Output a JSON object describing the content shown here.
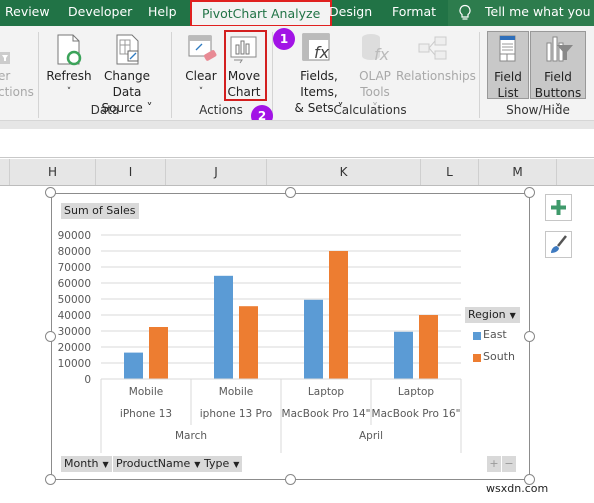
{
  "tabs": [
    {
      "label": "Review"
    },
    {
      "label": "Developer"
    },
    {
      "label": "Help"
    },
    {
      "label": "PivotChart Analyze",
      "active": true
    },
    {
      "label": "Design"
    },
    {
      "label": "Format"
    }
  ],
  "tell_me": {
    "placeholder": "Tell me what you wa",
    "icon": "lightbulb-icon"
  },
  "ribbon": {
    "partial_button": {
      "line1": "er",
      "line2": "ctions"
    },
    "data_group": {
      "label": "Data",
      "refresh": {
        "line1": "Refresh",
        "line2": "˅"
      },
      "change_data_source": {
        "line1": "Change Data",
        "line2": "Source ˅"
      }
    },
    "actions_group": {
      "label": "Actions",
      "clear": {
        "line1": "Clear",
        "line2": "˅"
      },
      "move_chart": {
        "line1": "Move",
        "line2": "Chart"
      }
    },
    "calculations_group": {
      "label": "Calculations",
      "fields_items_sets": {
        "line1": "Fields, Items,",
        "line2": "& Sets ˅"
      },
      "olap_tools": {
        "line1": "OLAP",
        "line2": "Tools ˅"
      },
      "relationships": {
        "line1": "Relationships"
      }
    },
    "showhide_group": {
      "label": "Show/Hide",
      "field_list": {
        "line1": "Field",
        "line2": "List"
      },
      "field_buttons": {
        "line1": "Field",
        "line2": "Buttons ˅"
      }
    }
  },
  "annotations": {
    "step1": "1",
    "step2": "2"
  },
  "columns": [
    "H",
    "I",
    "J",
    "K",
    "L",
    "M"
  ],
  "chart": {
    "value_field_button": "Sum of Sales",
    "legend_field_button": "Region",
    "axis_field_buttons": [
      "Month",
      "ProductName",
      "Type"
    ],
    "expand_label": "+",
    "collapse_label": "−"
  },
  "side_buttons": {
    "chart_elements": "plus-icon",
    "chart_styles": "brush-icon"
  },
  "chart_data": {
    "type": "bar",
    "title": "",
    "ylim": [
      0,
      90000
    ],
    "yticks": [
      "0",
      "10000",
      "20000",
      "30000",
      "40000",
      "50000",
      "60000",
      "70000",
      "80000",
      "90000"
    ],
    "categories": [
      {
        "type": "Mobile",
        "product": "iPhone 13",
        "month": "March"
      },
      {
        "type": "Mobile",
        "product": "iphone 13 Pro",
        "month": "March"
      },
      {
        "type": "Laptop",
        "product": "MacBook Pro 14\"",
        "month": "April"
      },
      {
        "type": "Laptop",
        "product": "MacBook Pro 16\"",
        "month": "April"
      }
    ],
    "months": [
      "March",
      "April"
    ],
    "series": [
      {
        "name": "East",
        "color": "#5b9bd5",
        "values": [
          16500,
          64500,
          49500,
          29500
        ]
      },
      {
        "name": "South",
        "color": "#ed7d31",
        "values": [
          32500,
          45500,
          80000,
          40000
        ]
      }
    ],
    "grid": true,
    "legend": "right"
  },
  "watermark": "wsxdn.com"
}
